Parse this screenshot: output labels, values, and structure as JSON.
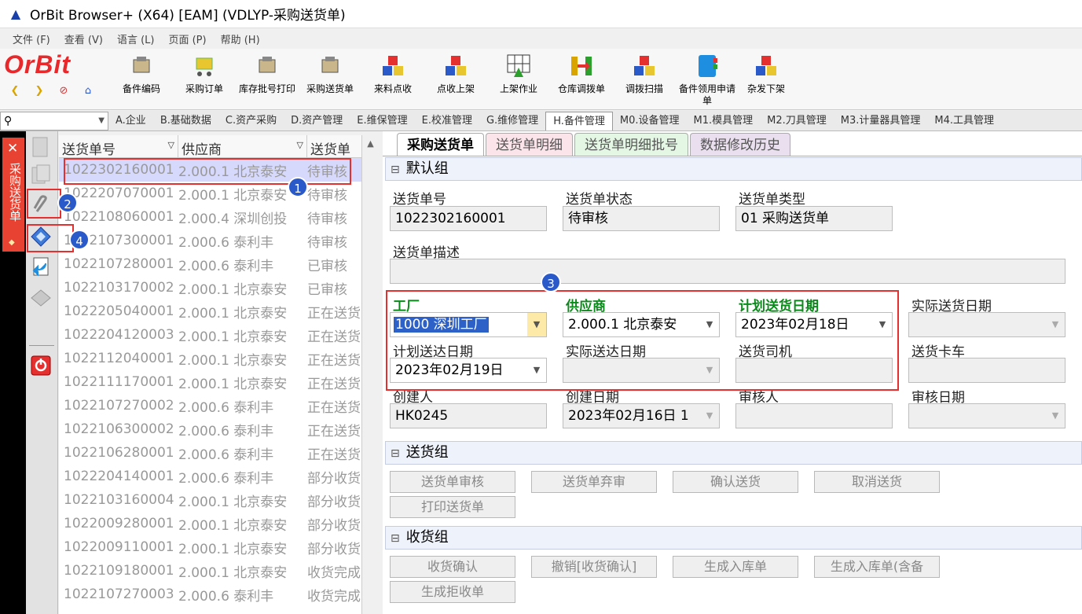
{
  "window": {
    "title": "OrBit Browser+ (X64) [EAM] (VDLYP-采购送货单)"
  },
  "menu": [
    "文件 (F)",
    "查看 (V)",
    "语言 (L)",
    "页面 (P)",
    "帮助 (H)"
  ],
  "logo": "OrBit",
  "toolbar": [
    "备件编码",
    "采购订单",
    "库存批号打印",
    "采购送货单",
    "来料点收",
    "点收上架",
    "上架作业",
    "仓库调拨单",
    "调拨扫描",
    "备件领用申请单",
    "杂发下架"
  ],
  "moduletabs": [
    "A.企业",
    "B.基础数据",
    "C.资产采购",
    "D.资产管理",
    "E.维保管理",
    "E.校准管理",
    "G.维修管理",
    "H.备件管理",
    "M0.设备管理",
    "M1.模具管理",
    "M2.刀具管理",
    "M3.计量器具管理",
    "M4.工具管理"
  ],
  "sidetab": "采购送货单",
  "list": {
    "headers": [
      "送货单号",
      "供应商",
      "送货单"
    ],
    "rows": [
      [
        "1022302160001",
        "2.000.1 北京泰安",
        "待审核"
      ],
      [
        "1022207070001",
        "2.000.1 北京泰安",
        "待审核"
      ],
      [
        "1022108060001",
        "2.000.4 深圳创投",
        "待审核"
      ],
      [
        "1022107300001",
        "2.000.6 泰利丰",
        "待审核"
      ],
      [
        "1022107280001",
        "2.000.6 泰利丰",
        "已审核"
      ],
      [
        "1022103170002",
        "2.000.1 北京泰安",
        "已审核"
      ],
      [
        "1022205040001",
        "2.000.1 北京泰安",
        "正在送货"
      ],
      [
        "1022204120003",
        "2.000.1 北京泰安",
        "正在送货"
      ],
      [
        "1022112040001",
        "2.000.1 北京泰安",
        "正在送货"
      ],
      [
        "1022111170001",
        "2.000.1 北京泰安",
        "正在送货"
      ],
      [
        "1022107270002",
        "2.000.6 泰利丰",
        "正在送货"
      ],
      [
        "1022106300002",
        "2.000.6 泰利丰",
        "正在送货"
      ],
      [
        "1022106280001",
        "2.000.6 泰利丰",
        "正在送货"
      ],
      [
        "1022204140001",
        "2.000.6 泰利丰",
        "部分收货"
      ],
      [
        "1022103160004",
        "2.000.1 北京泰安",
        "部分收货"
      ],
      [
        "1022009280001",
        "2.000.1 北京泰安",
        "部分收货"
      ],
      [
        "1022009110001",
        "2.000.1 北京泰安",
        "部分收货"
      ],
      [
        "1022109180001",
        "2.000.1 北京泰安",
        "收货完成"
      ],
      [
        "1022107270003",
        "2.000.6 泰利丰",
        "收货完成"
      ]
    ]
  },
  "formtabs": [
    "采购送货单",
    "送货单明细",
    "送货单明细批号",
    "数据修改历史"
  ],
  "groups": {
    "default": "默认组",
    "delivery": "送货组",
    "receive": "收货组"
  },
  "fields": {
    "no_label": "送货单号",
    "no": "1022302160001",
    "status_label": "送货单状态",
    "status": "待审核",
    "type_label": "送货单类型",
    "type": "01 采购送货单",
    "desc_label": "送货单描述",
    "plant_label": "工厂",
    "plant": "1000 深圳工厂",
    "supplier_label": "供应商",
    "supplier": "2.000.1 北京泰安",
    "plandate_label": "计划送货日期",
    "plandate": "2023年02月18日",
    "actdate_label": "实际送货日期",
    "planarrive_label": "计划送达日期",
    "planarrive": "2023年02月19日",
    "actarrive_label": "实际送达日期",
    "driver_label": "送货司机",
    "truck_label": "送货卡车",
    "creator_label": "创建人",
    "creator": "HK0245",
    "created_label": "创建日期",
    "created": "2023年02月16日 1",
    "auditor_label": "审核人",
    "audited_label": "审核日期"
  },
  "delivery_buttons": [
    "送货单审核",
    "送货单弃审",
    "确认送货",
    "取消送货",
    "打印送货单"
  ],
  "receive_buttons": [
    "收货确认",
    "撤销[收货确认]",
    "生成入库单",
    "生成入库单(含备",
    "生成拒收单"
  ],
  "badges": [
    "1",
    "2",
    "3",
    "4"
  ]
}
